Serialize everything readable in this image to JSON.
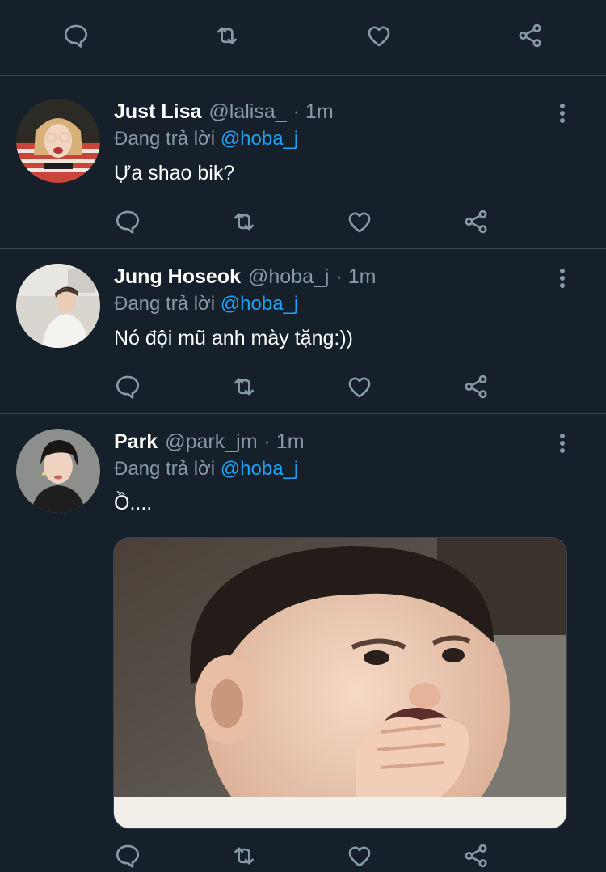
{
  "icons": {
    "reply": "reply-icon",
    "retweet": "retweet-icon",
    "like": "heart-icon",
    "share": "share-icon",
    "more": "more-vertical-icon"
  },
  "colors": {
    "background": "#15202b",
    "divider": "#38444d",
    "secondary_text": "#8899a6",
    "mention": "#1da1f2",
    "primary_text": "#ffffff"
  },
  "replies": [
    {
      "display_name": "Just Lisa",
      "handle": "@lalisa_",
      "time": "· 1m",
      "replying_prefix": "Đang trả lời",
      "replying_to": "@hoba_j",
      "text": "Ựa shao bik?"
    },
    {
      "display_name": "Jung Hoseok",
      "handle": "@hoba_j",
      "time": "· 1m",
      "replying_prefix": "Đang trả lời",
      "replying_to": "@hoba_j",
      "text": "Nó đội mũ anh mày tặng:))"
    },
    {
      "display_name": "Park",
      "handle": "@park_jm",
      "time": "· 1m",
      "replying_prefix": "Đang trả lời",
      "replying_to": "@hoba_j",
      "text": "Ồ...."
    }
  ]
}
